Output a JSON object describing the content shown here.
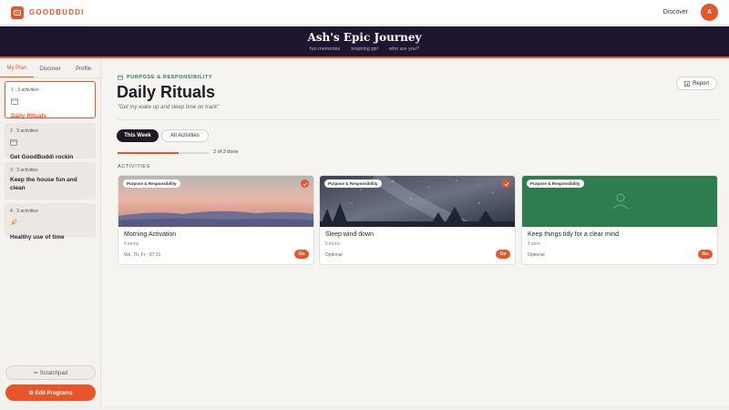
{
  "app": {
    "logo_text": "GOODBUDDI",
    "nav_discover": "Discover",
    "avatar_initial": "A",
    "accent": "#e8552a"
  },
  "banner": {
    "title": "Ash's Epic Journey",
    "links": [
      "fun memories",
      "inspiring pp!",
      "who are you?"
    ]
  },
  "sidebar": {
    "tabs": [
      "My Plan",
      "Discover",
      "Profile"
    ],
    "active_tab": "My Plan",
    "plans": [
      {
        "meta": "1 · 3 activities",
        "icon": "calendar-icon",
        "title": "Daily Rituals",
        "active": true
      },
      {
        "meta": "2 · 3 activities",
        "icon": "calendar-icon",
        "title": "Get GoodBuddi rockin",
        "active": false
      },
      {
        "meta": "3 · 3 activities",
        "icon": "none",
        "title": "Keep the house fun and clean",
        "active": false
      },
      {
        "meta": "4 · 3 activities",
        "icon": "party-icon",
        "title": "Healthy use of time",
        "active": false
      }
    ],
    "scratchpad_label": "✏ Scratchpad",
    "edit_programs_label": "⚙ Edit Programs"
  },
  "main": {
    "kicker": "PURPOSE & RESPONSIBILITY",
    "title": "Daily Rituals",
    "subtitle": "\"Get my wake up and sleep time on track\"",
    "report_label": "Report",
    "filters": [
      "This Week",
      "All Activities"
    ],
    "progress_text": "2 of 3 done",
    "progress_fraction": 0.67,
    "section_label": "ACTIVITIES",
    "activities": [
      {
        "tag": "Purpose & Responsibility",
        "title": "Morning Activation",
        "items": "4 items",
        "footer": "We, Th, Fr · 07:31",
        "done": true,
        "go_label": "Go",
        "image": "sunset-mountains"
      },
      {
        "tag": "Purpose & Responsibility",
        "title": "Sleep wind down",
        "items": "6 items",
        "footer": "Optional",
        "done": true,
        "go_label": "Go",
        "image": "night-sky-trees"
      },
      {
        "tag": "Purpose & Responsibility",
        "title": "Keep things tidy for a clear mind",
        "items": "1 item",
        "footer": "Optional",
        "done": false,
        "go_label": "Go",
        "image": "green-placeholder"
      }
    ]
  }
}
